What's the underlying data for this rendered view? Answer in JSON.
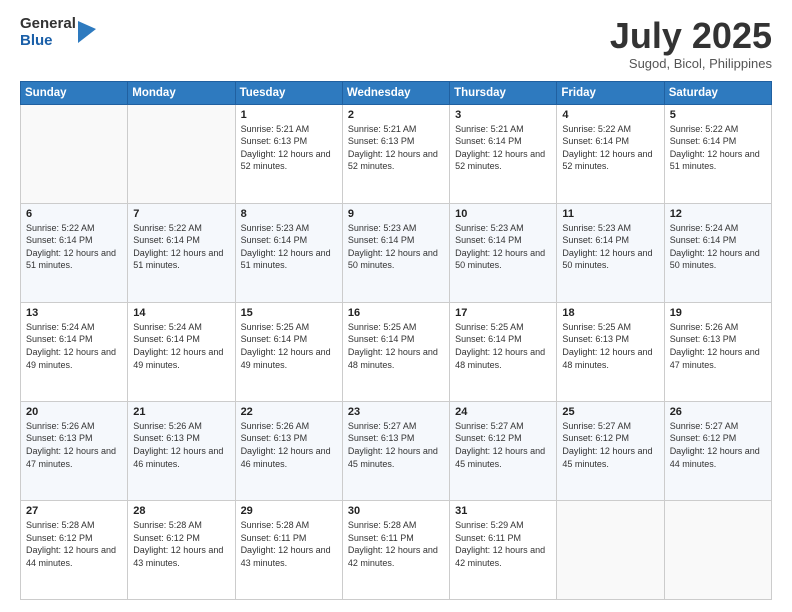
{
  "header": {
    "logo_general": "General",
    "logo_blue": "Blue",
    "month": "July 2025",
    "location": "Sugod, Bicol, Philippines"
  },
  "days_of_week": [
    "Sunday",
    "Monday",
    "Tuesday",
    "Wednesday",
    "Thursday",
    "Friday",
    "Saturday"
  ],
  "weeks": [
    [
      {
        "day": "",
        "sunrise": "",
        "sunset": "",
        "daylight": ""
      },
      {
        "day": "",
        "sunrise": "",
        "sunset": "",
        "daylight": ""
      },
      {
        "day": "1",
        "sunrise": "Sunrise: 5:21 AM",
        "sunset": "Sunset: 6:13 PM",
        "daylight": "Daylight: 12 hours and 52 minutes."
      },
      {
        "day": "2",
        "sunrise": "Sunrise: 5:21 AM",
        "sunset": "Sunset: 6:13 PM",
        "daylight": "Daylight: 12 hours and 52 minutes."
      },
      {
        "day": "3",
        "sunrise": "Sunrise: 5:21 AM",
        "sunset": "Sunset: 6:14 PM",
        "daylight": "Daylight: 12 hours and 52 minutes."
      },
      {
        "day": "4",
        "sunrise": "Sunrise: 5:22 AM",
        "sunset": "Sunset: 6:14 PM",
        "daylight": "Daylight: 12 hours and 52 minutes."
      },
      {
        "day": "5",
        "sunrise": "Sunrise: 5:22 AM",
        "sunset": "Sunset: 6:14 PM",
        "daylight": "Daylight: 12 hours and 51 minutes."
      }
    ],
    [
      {
        "day": "6",
        "sunrise": "Sunrise: 5:22 AM",
        "sunset": "Sunset: 6:14 PM",
        "daylight": "Daylight: 12 hours and 51 minutes."
      },
      {
        "day": "7",
        "sunrise": "Sunrise: 5:22 AM",
        "sunset": "Sunset: 6:14 PM",
        "daylight": "Daylight: 12 hours and 51 minutes."
      },
      {
        "day": "8",
        "sunrise": "Sunrise: 5:23 AM",
        "sunset": "Sunset: 6:14 PM",
        "daylight": "Daylight: 12 hours and 51 minutes."
      },
      {
        "day": "9",
        "sunrise": "Sunrise: 5:23 AM",
        "sunset": "Sunset: 6:14 PM",
        "daylight": "Daylight: 12 hours and 50 minutes."
      },
      {
        "day": "10",
        "sunrise": "Sunrise: 5:23 AM",
        "sunset": "Sunset: 6:14 PM",
        "daylight": "Daylight: 12 hours and 50 minutes."
      },
      {
        "day": "11",
        "sunrise": "Sunrise: 5:23 AM",
        "sunset": "Sunset: 6:14 PM",
        "daylight": "Daylight: 12 hours and 50 minutes."
      },
      {
        "day": "12",
        "sunrise": "Sunrise: 5:24 AM",
        "sunset": "Sunset: 6:14 PM",
        "daylight": "Daylight: 12 hours and 50 minutes."
      }
    ],
    [
      {
        "day": "13",
        "sunrise": "Sunrise: 5:24 AM",
        "sunset": "Sunset: 6:14 PM",
        "daylight": "Daylight: 12 hours and 49 minutes."
      },
      {
        "day": "14",
        "sunrise": "Sunrise: 5:24 AM",
        "sunset": "Sunset: 6:14 PM",
        "daylight": "Daylight: 12 hours and 49 minutes."
      },
      {
        "day": "15",
        "sunrise": "Sunrise: 5:25 AM",
        "sunset": "Sunset: 6:14 PM",
        "daylight": "Daylight: 12 hours and 49 minutes."
      },
      {
        "day": "16",
        "sunrise": "Sunrise: 5:25 AM",
        "sunset": "Sunset: 6:14 PM",
        "daylight": "Daylight: 12 hours and 48 minutes."
      },
      {
        "day": "17",
        "sunrise": "Sunrise: 5:25 AM",
        "sunset": "Sunset: 6:14 PM",
        "daylight": "Daylight: 12 hours and 48 minutes."
      },
      {
        "day": "18",
        "sunrise": "Sunrise: 5:25 AM",
        "sunset": "Sunset: 6:13 PM",
        "daylight": "Daylight: 12 hours and 48 minutes."
      },
      {
        "day": "19",
        "sunrise": "Sunrise: 5:26 AM",
        "sunset": "Sunset: 6:13 PM",
        "daylight": "Daylight: 12 hours and 47 minutes."
      }
    ],
    [
      {
        "day": "20",
        "sunrise": "Sunrise: 5:26 AM",
        "sunset": "Sunset: 6:13 PM",
        "daylight": "Daylight: 12 hours and 47 minutes."
      },
      {
        "day": "21",
        "sunrise": "Sunrise: 5:26 AM",
        "sunset": "Sunset: 6:13 PM",
        "daylight": "Daylight: 12 hours and 46 minutes."
      },
      {
        "day": "22",
        "sunrise": "Sunrise: 5:26 AM",
        "sunset": "Sunset: 6:13 PM",
        "daylight": "Daylight: 12 hours and 46 minutes."
      },
      {
        "day": "23",
        "sunrise": "Sunrise: 5:27 AM",
        "sunset": "Sunset: 6:13 PM",
        "daylight": "Daylight: 12 hours and 45 minutes."
      },
      {
        "day": "24",
        "sunrise": "Sunrise: 5:27 AM",
        "sunset": "Sunset: 6:12 PM",
        "daylight": "Daylight: 12 hours and 45 minutes."
      },
      {
        "day": "25",
        "sunrise": "Sunrise: 5:27 AM",
        "sunset": "Sunset: 6:12 PM",
        "daylight": "Daylight: 12 hours and 45 minutes."
      },
      {
        "day": "26",
        "sunrise": "Sunrise: 5:27 AM",
        "sunset": "Sunset: 6:12 PM",
        "daylight": "Daylight: 12 hours and 44 minutes."
      }
    ],
    [
      {
        "day": "27",
        "sunrise": "Sunrise: 5:28 AM",
        "sunset": "Sunset: 6:12 PM",
        "daylight": "Daylight: 12 hours and 44 minutes."
      },
      {
        "day": "28",
        "sunrise": "Sunrise: 5:28 AM",
        "sunset": "Sunset: 6:12 PM",
        "daylight": "Daylight: 12 hours and 43 minutes."
      },
      {
        "day": "29",
        "sunrise": "Sunrise: 5:28 AM",
        "sunset": "Sunset: 6:11 PM",
        "daylight": "Daylight: 12 hours and 43 minutes."
      },
      {
        "day": "30",
        "sunrise": "Sunrise: 5:28 AM",
        "sunset": "Sunset: 6:11 PM",
        "daylight": "Daylight: 12 hours and 42 minutes."
      },
      {
        "day": "31",
        "sunrise": "Sunrise: 5:29 AM",
        "sunset": "Sunset: 6:11 PM",
        "daylight": "Daylight: 12 hours and 42 minutes."
      },
      {
        "day": "",
        "sunrise": "",
        "sunset": "",
        "daylight": ""
      },
      {
        "day": "",
        "sunrise": "",
        "sunset": "",
        "daylight": ""
      }
    ]
  ]
}
